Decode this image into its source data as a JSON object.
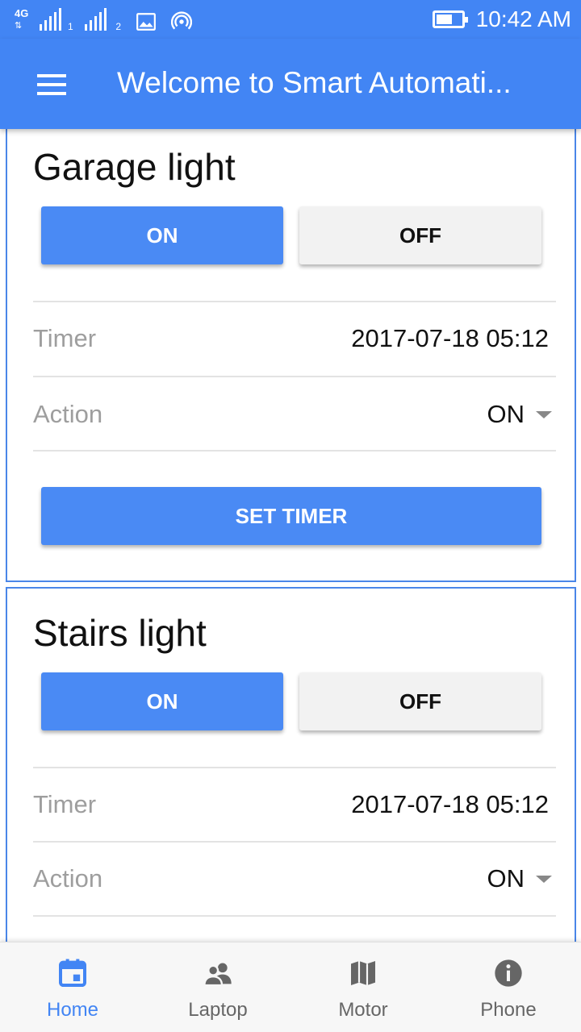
{
  "status_bar": {
    "network_type": "4G",
    "sim1_label": "1",
    "sim2_label": "2",
    "time": "10:42 AM",
    "icons": [
      "signal-icon",
      "image-icon",
      "hotspot-icon",
      "battery-icon"
    ],
    "battery_level": 0.65
  },
  "app_bar": {
    "title": "Welcome to Smart Automati...",
    "menu_icon": "menu-icon",
    "color": "#4285f4"
  },
  "devices": [
    {
      "name": "Garage light",
      "on_label": "ON",
      "off_label": "OFF",
      "timer_label": "Timer",
      "timer_value": "2017-07-18 05:12",
      "action_label": "Action",
      "action_value": "ON",
      "set_timer_label": "SET TIMER"
    },
    {
      "name": "Stairs light",
      "on_label": "ON",
      "off_label": "OFF",
      "timer_label": "Timer",
      "timer_value": "2017-07-18 05:12",
      "action_label": "Action",
      "action_value": "ON"
    }
  ],
  "bottom_nav": {
    "items": [
      {
        "label": "Home",
        "icon": "calendar-icon",
        "active": true
      },
      {
        "label": "Laptop",
        "icon": "people-icon",
        "active": false
      },
      {
        "label": "Motor",
        "icon": "map-icon",
        "active": false
      },
      {
        "label": "Phone",
        "icon": "info-icon",
        "active": false
      }
    ]
  },
  "colors": {
    "accent": "#4285f4",
    "button_primary": "#4a8af4",
    "button_secondary": "#f2f2f2",
    "card_border": "#4a86e8"
  }
}
